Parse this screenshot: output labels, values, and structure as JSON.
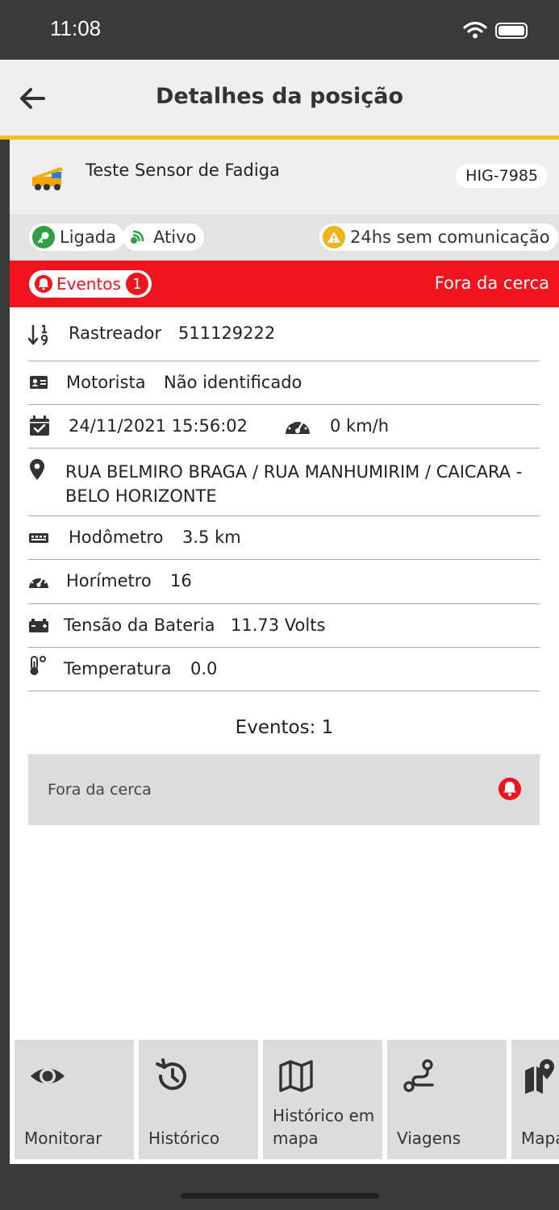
{
  "status_bar": {
    "time": "11:08",
    "icons": [
      "wifi-icon",
      "battery-icon"
    ]
  },
  "header": {
    "title": "Detalhes da posição",
    "back_icon": "arrow-left-icon"
  },
  "colors": {
    "accent": "#f4c020",
    "alert": "#f1131d",
    "ok": "#2ea043",
    "warning": "#f2b21b"
  },
  "vehicle": {
    "name": "Teste Sensor de Fadiga",
    "plate": "HIG-7985",
    "icon": "crane-truck-icon"
  },
  "statuses": [
    {
      "label": "Ligada",
      "icon": "key-icon"
    },
    {
      "label": "Ativo",
      "icon": "signal-icon"
    },
    {
      "label": "24hs sem comunicação",
      "icon": "warning-icon"
    }
  ],
  "event_bar": {
    "label": "Eventos",
    "count": "1",
    "right_text": "Fora da cerca"
  },
  "details": {
    "tracker": {
      "label": "Rastreador",
      "value": "511129222"
    },
    "driver": {
      "label": "Motorista",
      "value": "Não identificado"
    },
    "datetime": "24/11/2021 15:56:02",
    "speed": "0 km/h",
    "address": "RUA BELMIRO BRAGA / RUA MANHUMIRIM / CAICARA - BELO HORIZONTE",
    "odometer": {
      "label": "Hodômetro",
      "value": "3.5 km"
    },
    "hourmeter": {
      "label": "Horímetro",
      "value": "16"
    },
    "battery": {
      "label": "Tensão da Bateria",
      "value": "11.73 Volts"
    },
    "temperature": {
      "label": "Temperatura",
      "value": "0.0"
    }
  },
  "events_section": {
    "title": "Eventos: 1",
    "items": [
      {
        "label": "Fora da cerca",
        "icon": "bell-icon"
      }
    ]
  },
  "bottom_nav": [
    {
      "label": "Monitorar",
      "icon": "eye-icon"
    },
    {
      "label": "Histórico",
      "icon": "history-icon"
    },
    {
      "label": "Histórico em mapa",
      "icon": "map-icon"
    },
    {
      "label": "Viagens",
      "icon": "route-icon"
    },
    {
      "label": "Mapa externo",
      "icon": "map-marker-icon"
    }
  ]
}
